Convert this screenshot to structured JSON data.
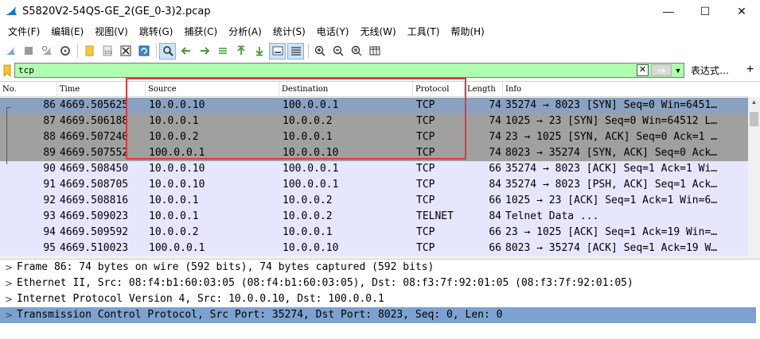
{
  "window": {
    "title": "S5820V2-54QS-GE_2(GE_0-3)2.pcap",
    "minimize": "—",
    "maximize": "☐",
    "close": "✕"
  },
  "menu": [
    "文件(F)",
    "编辑(E)",
    "视图(V)",
    "跳转(G)",
    "捕获(C)",
    "分析(A)",
    "统计(S)",
    "电话(Y)",
    "无线(W)",
    "工具(T)",
    "帮助(H)"
  ],
  "filter": {
    "value": "tcp",
    "clear_icon": "✕",
    "apply_icon": "⇒",
    "dropdown_icon": "▼",
    "expression_label": "表达式…",
    "add_label": "+"
  },
  "columns": [
    "No.",
    "Time",
    "Source",
    "Destination",
    "Protocol",
    "Length",
    "Info"
  ],
  "packets": [
    {
      "no": "86",
      "time": "4669.505625",
      "src": "10.0.0.10",
      "dst": "100.0.0.1",
      "proto": "TCP",
      "len": "74",
      "info": "35274 → 8023 [SYN] Seq=0 Win=6451…",
      "style": "sel"
    },
    {
      "no": "87",
      "time": "4669.506188",
      "src": "10.0.0.1",
      "dst": "10.0.0.2",
      "proto": "TCP",
      "len": "74",
      "info": "1025 → 23 [SYN] Seq=0 Win=64512 L…",
      "style": "gray"
    },
    {
      "no": "88",
      "time": "4669.507240",
      "src": "10.0.0.2",
      "dst": "10.0.0.1",
      "proto": "TCP",
      "len": "74",
      "info": "23 → 1025 [SYN, ACK] Seq=0 Ack=1 …",
      "style": "gray"
    },
    {
      "no": "89",
      "time": "4669.507552",
      "src": "100.0.0.1",
      "dst": "10.0.0.10",
      "proto": "TCP",
      "len": "74",
      "info": "8023 → 35274 [SYN, ACK] Seq=0 Ack…",
      "style": "gray"
    },
    {
      "no": "90",
      "time": "4669.508450",
      "src": "10.0.0.10",
      "dst": "100.0.0.1",
      "proto": "TCP",
      "len": "66",
      "info": "35274 → 8023 [ACK] Seq=1 Ack=1 Wi…",
      "style": "tcp"
    },
    {
      "no": "91",
      "time": "4669.508705",
      "src": "10.0.0.10",
      "dst": "100.0.0.1",
      "proto": "TCP",
      "len": "84",
      "info": "35274 → 8023 [PSH, ACK] Seq=1 Ack…",
      "style": "tcp"
    },
    {
      "no": "92",
      "time": "4669.508816",
      "src": "10.0.0.1",
      "dst": "10.0.0.2",
      "proto": "TCP",
      "len": "66",
      "info": "1025 → 23 [ACK] Seq=1 Ack=1 Win=6…",
      "style": "tcp"
    },
    {
      "no": "93",
      "time": "4669.509023",
      "src": "10.0.0.1",
      "dst": "10.0.0.2",
      "proto": "TELNET",
      "len": "84",
      "info": "Telnet Data ...",
      "style": "tcp"
    },
    {
      "no": "94",
      "time": "4669.509592",
      "src": "10.0.0.2",
      "dst": "10.0.0.1",
      "proto": "TCP",
      "len": "66",
      "info": "23 → 1025 [ACK] Seq=1 Ack=19 Win=…",
      "style": "tcp"
    },
    {
      "no": "95",
      "time": "4669.510023",
      "src": "100.0.0.1",
      "dst": "10.0.0.10",
      "proto": "TCP",
      "len": "66",
      "info": "8023 → 35274 [ACK] Seq=1 Ack=19 W…",
      "style": "tcp"
    }
  ],
  "details": [
    {
      "text": "Frame 86: 74 bytes on wire (592 bits), 74 bytes captured (592 bits)",
      "selected": false
    },
    {
      "text": "Ethernet II, Src: 08:f4:b1:60:03:05 (08:f4:b1:60:03:05), Dst: 08:f3:7f:92:01:05 (08:f3:7f:92:01:05)",
      "selected": false
    },
    {
      "text": "Internet Protocol Version 4, Src: 10.0.0.10, Dst: 100.0.0.1",
      "selected": false
    },
    {
      "text": "Transmission Control Protocol, Src Port: 35274, Dst Port: 8023, Seq: 0, Len: 0",
      "selected": true
    }
  ],
  "colors": {
    "tcp_row": "#e7e6ff",
    "selected_row": "#8aa2c0",
    "filter_valid": "#afffaf",
    "annotation": "#e0393c"
  }
}
